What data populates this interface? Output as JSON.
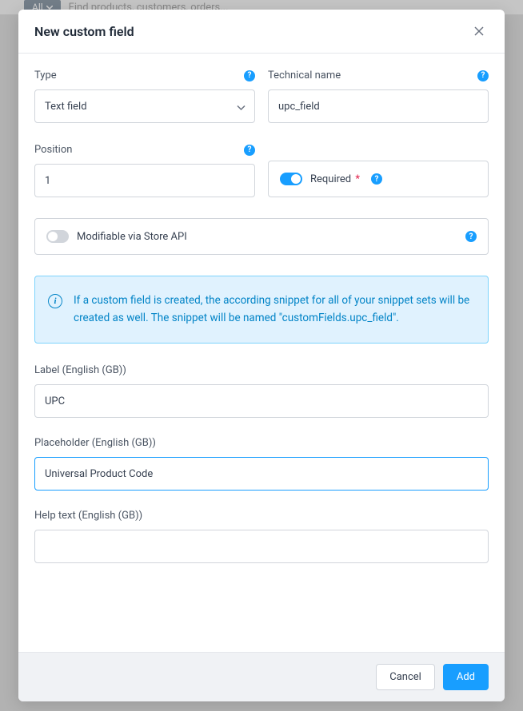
{
  "background": {
    "all_label": "All",
    "search_placeholder": "Find products, customers, orders..."
  },
  "modal": {
    "title": "New custom field",
    "footer": {
      "cancel": "Cancel",
      "add": "Add"
    }
  },
  "fields": {
    "type": {
      "label": "Type",
      "value": "Text field"
    },
    "technical_name": {
      "label": "Technical name",
      "value": "upc_field"
    },
    "position": {
      "label": "Position",
      "value": "1"
    },
    "required": {
      "label": "Required"
    },
    "modifiable": {
      "label": "Modifiable via Store API"
    },
    "label_en": {
      "label": "Label (English (GB))",
      "value": "UPC"
    },
    "placeholder_en": {
      "label": "Placeholder (English (GB))",
      "value": "Universal Product Code"
    },
    "help_text_en": {
      "label": "Help text (English (GB))",
      "value": ""
    }
  },
  "info": {
    "text": "If a custom field is created, the according snippet for all of your snippet sets will be created as well. The snippet will be named \"customFields.upc_field\"."
  }
}
